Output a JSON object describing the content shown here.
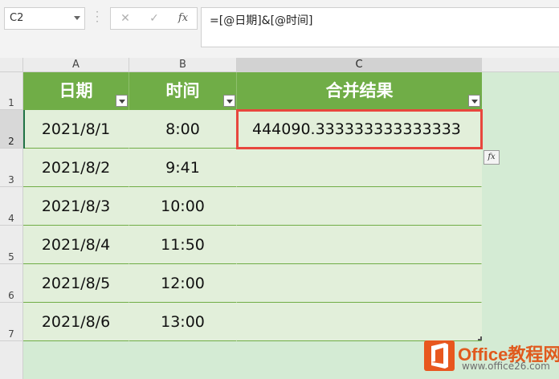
{
  "name_box": {
    "value": "C2"
  },
  "formula_bar": {
    "cancel_icon": "✕",
    "enter_icon": "✓",
    "fx_label": "fx",
    "formula": "=[@日期]&[@时间]"
  },
  "columns": [
    "A",
    "B",
    "C"
  ],
  "rows": [
    "1",
    "2",
    "3",
    "4",
    "5",
    "6",
    "7"
  ],
  "table": {
    "headers": [
      "日期",
      "时间",
      "合并结果"
    ],
    "data": [
      [
        "2021/8/1",
        "8:00",
        "444090.333333333333333"
      ],
      [
        "2021/8/2",
        "9:41",
        ""
      ],
      [
        "2021/8/3",
        "10:00",
        ""
      ],
      [
        "2021/8/4",
        "11:50",
        ""
      ],
      [
        "2021/8/5",
        "12:00",
        ""
      ],
      [
        "2021/8/6",
        "13:00",
        ""
      ]
    ]
  },
  "colors": {
    "header_green": "#70ad47",
    "band_green": "#e2efda",
    "highlight_red": "#e8473e"
  },
  "watermark": {
    "title": "Office教程网",
    "url": "www.office26.com"
  }
}
